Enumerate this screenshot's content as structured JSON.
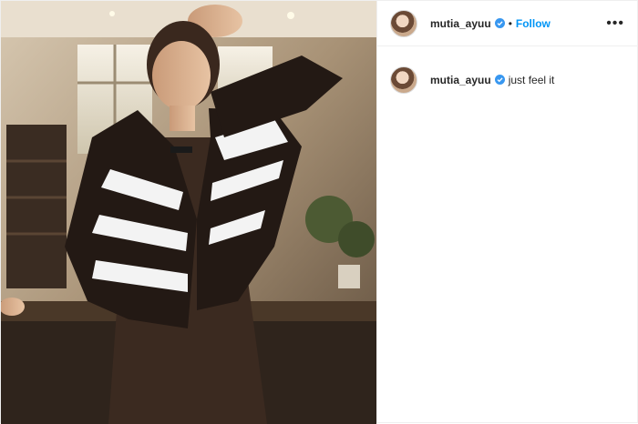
{
  "post": {
    "header": {
      "username": "mutia_ayuu",
      "separator": "•",
      "follow_label": "Follow",
      "more_icon": "more-options-icon"
    },
    "caption": {
      "username": "mutia_ayuu",
      "text": "just feel it"
    },
    "colors": {
      "follow_blue": "#0095f6",
      "verified_blue": "#3897f0",
      "text_dark": "#262626",
      "border": "#efefef"
    }
  }
}
